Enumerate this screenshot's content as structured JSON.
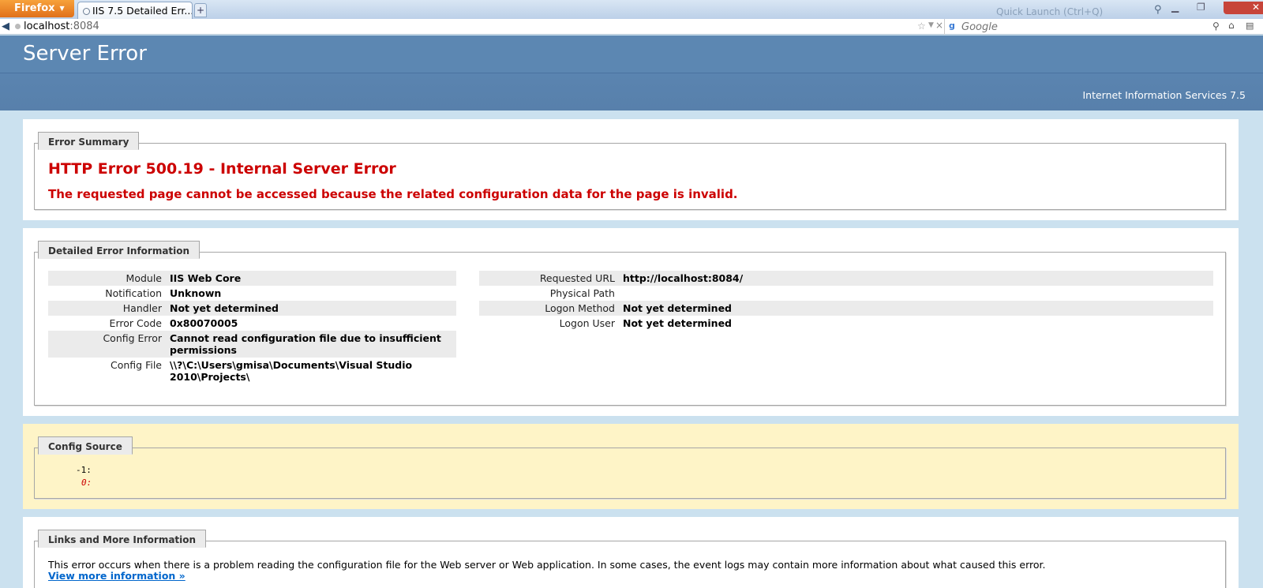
{
  "browser": {
    "app_button": "Firefox",
    "tab_title": "IIS 7.5 Detailed Err...",
    "new_tab": "+",
    "quick_launch": "Quick Launch (Ctrl+Q)",
    "url_host": "localhost",
    "url_port": ":8084",
    "search_placeholder": "Google"
  },
  "header": {
    "title": "Server Error",
    "product": "Internet Information Services 7.5"
  },
  "summary": {
    "legend": "Error Summary",
    "title": "HTTP Error 500.19 - Internal Server Error",
    "message": "The requested page cannot be accessed because the related configuration data for the page is invalid."
  },
  "details": {
    "legend": "Detailed Error Information",
    "left": [
      {
        "key": "Module",
        "value": "IIS Web Core"
      },
      {
        "key": "Notification",
        "value": "Unknown"
      },
      {
        "key": "Handler",
        "value": "Not yet determined"
      },
      {
        "key": "Error Code",
        "value": "0x80070005"
      },
      {
        "key": "Config Error",
        "value": "Cannot read configuration file due to insufficient permissions"
      },
      {
        "key": "Config File",
        "value": "\\\\?\\C:\\Users\\gmisa\\Documents\\Visual Studio 2010\\Projects\\"
      }
    ],
    "right": [
      {
        "key": "Requested URL",
        "value": "http://localhost:8084/"
      },
      {
        "key": "Physical Path",
        "value": ""
      },
      {
        "key": "Logon Method",
        "value": "Not yet determined"
      },
      {
        "key": "Logon User",
        "value": "Not yet determined"
      }
    ]
  },
  "config_source": {
    "legend": "Config Source",
    "line1": "-1:",
    "line2": "0:"
  },
  "links": {
    "legend": "Links and More Information",
    "text": "This error occurs when there is a problem reading the configuration file for the Web server or Web application. In some cases, the event logs may contain more information about what caused this error.",
    "link": "View more information »"
  },
  "colors": {
    "header": "#5c87b2",
    "error_red": "#cc0000",
    "link_blue": "#0066cc",
    "source_bg": "#fef4c7"
  }
}
